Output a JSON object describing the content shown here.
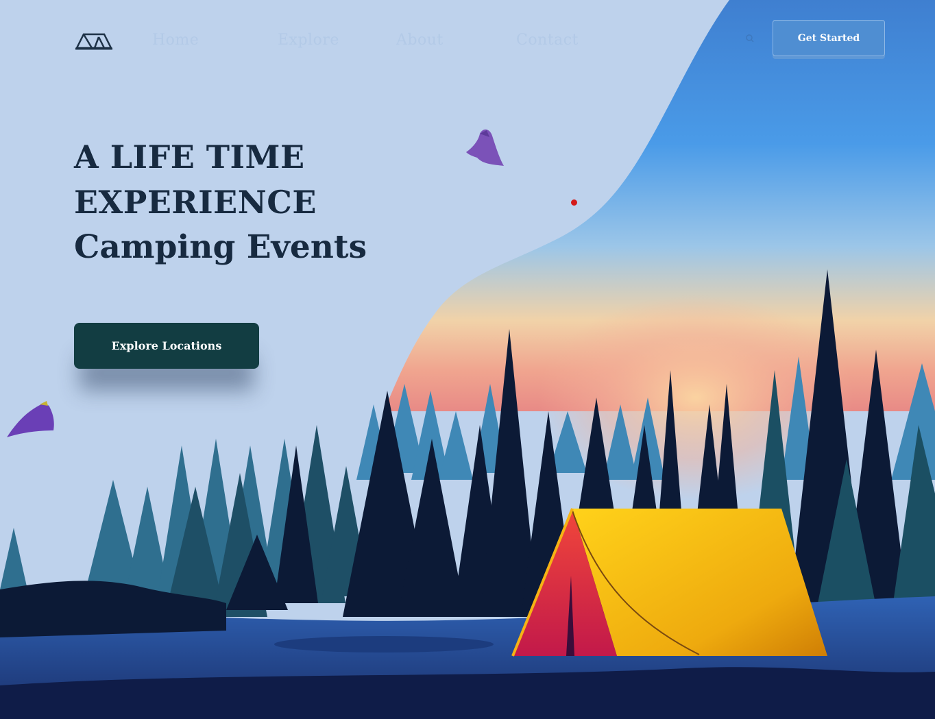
{
  "nav": {
    "logo": "tent-logo-icon",
    "links": [
      "Home",
      "Explore",
      "About",
      "Contact"
    ],
    "cta_label": "Get Started"
  },
  "hero": {
    "title_line1": "A LIFE TIME",
    "title_line2": "EXPERIENCE",
    "title_line3": "Camping Events",
    "button_label": "Explore Locations"
  },
  "colors": {
    "sky": "#bfd3ec",
    "title": "#172a40",
    "button": "#123d42",
    "cta": "#4f8ed2",
    "tent": "#f5b60f"
  }
}
